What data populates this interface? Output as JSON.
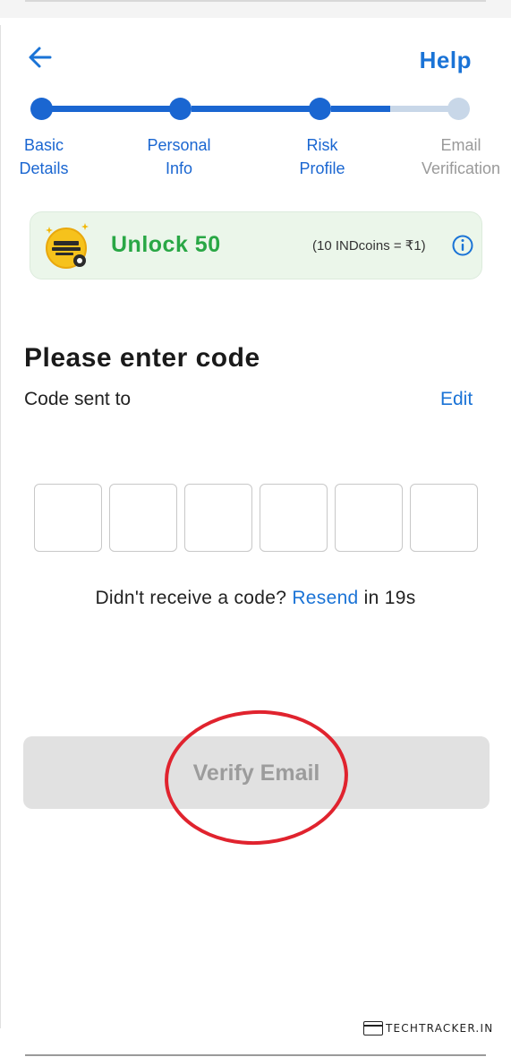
{
  "header": {
    "back_icon": "arrow-left-icon",
    "help_label": "Help"
  },
  "stepper": {
    "steps": [
      {
        "label": "Basic\nDetails",
        "state": "completed"
      },
      {
        "label": "Personal\nInfo",
        "state": "completed"
      },
      {
        "label": "Risk\nProfile",
        "state": "completed"
      },
      {
        "label": "Email\nVerification",
        "state": "current"
      }
    ],
    "colors": {
      "active": "#1a66d1",
      "inactive": "#c8d7e8",
      "inactive_label": "#9a9a9a"
    }
  },
  "promo": {
    "title": "Unlock 50",
    "rate": "(10 INDcoins = ₹1)",
    "badge_icon": "good-investor-coin-icon",
    "info_icon": "info-icon"
  },
  "verification": {
    "title": "Please enter code",
    "sent_to_label": "Code sent to",
    "edit_label": "Edit",
    "code_length": 6,
    "resend_prefix": "Didn't receive a code? ",
    "resend_link": "Resend",
    "resend_suffix": " in 19s"
  },
  "actions": {
    "verify_label": "Verify Email"
  },
  "watermark": {
    "text": "TECHTRACKER.IN"
  },
  "colors": {
    "accent": "#1a73d6",
    "promo_green": "#29a745",
    "annotation_red": "#e0232e"
  }
}
